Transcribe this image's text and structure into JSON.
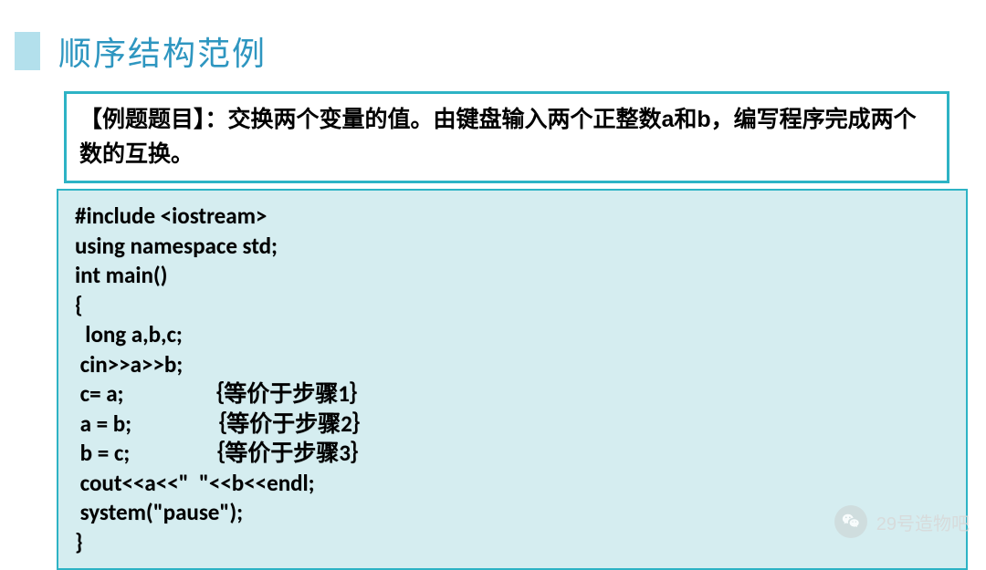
{
  "title": "顺序结构范例",
  "problem": "【例题题目】：交换两个变量的值。由键盘输入两个正整数a和b，编写程序完成两个数的互换。",
  "code_lines": [
    "#include <iostream>",
    "using namespace std;",
    "int main()",
    "{",
    "  long a,b,c;",
    " cin>>a>>b;",
    " c= a;               ｛等价于步骤1｝",
    " a = b;              ｛等价于步骤2｝",
    " b = c;              ｛等价于步骤3｝",
    " cout<<a<<\"  \"<<b<<endl;",
    " system(\"pause\");",
    "}"
  ],
  "watermark_text": "29号造物吧"
}
